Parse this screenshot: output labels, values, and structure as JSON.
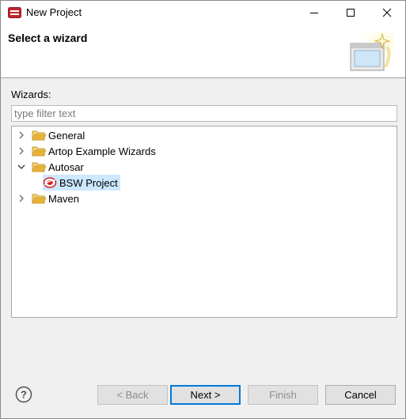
{
  "window": {
    "title": "New Project",
    "icon": "eclipse-app-icon",
    "controls": [
      "minimize-icon",
      "maximize-icon",
      "close-icon"
    ]
  },
  "banner": {
    "title": "Select a wizard",
    "image": "new-wizard-banner-icon"
  },
  "wizards": {
    "label": "Wizards:",
    "filter_placeholder": "type filter text",
    "filter_value": "",
    "tree": [
      {
        "label": "General",
        "expanded": false,
        "icon": "folder-icon"
      },
      {
        "label": "Artop Example Wizards",
        "expanded": false,
        "icon": "folder-icon"
      },
      {
        "label": "Autosar",
        "expanded": true,
        "icon": "folder-open-icon",
        "children": [
          {
            "label": "BSW Project",
            "selected": true,
            "icon": "bsw-project-icon"
          }
        ]
      },
      {
        "label": "Maven",
        "expanded": false,
        "icon": "folder-icon"
      }
    ]
  },
  "footer": {
    "help_icon": "help-icon",
    "back_label": "< Back",
    "next_label": "Next >",
    "finish_label": "Finish",
    "cancel_label": "Cancel"
  },
  "colors": {
    "selection": "#cce8ff",
    "default_button_border": "#0078d7",
    "dialog_bg": "#f0f0f0",
    "folder": "#e8b23a",
    "bsw_icon": "#d9232a"
  }
}
